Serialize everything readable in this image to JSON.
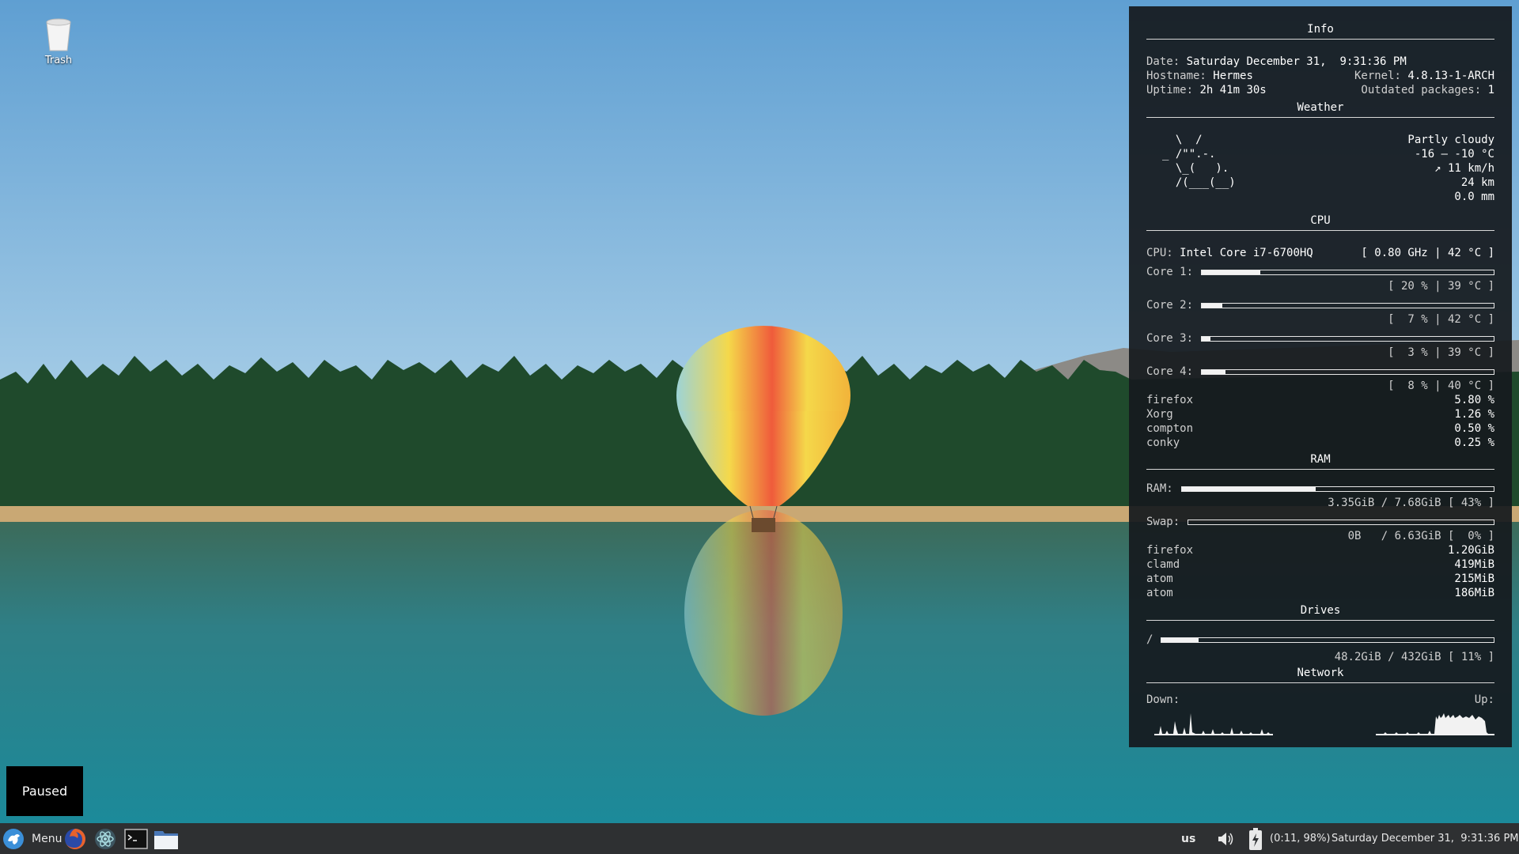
{
  "desktop": {
    "icons": [
      {
        "label": "Trash",
        "icon": "trash-icon"
      }
    ]
  },
  "conky": {
    "info": {
      "title": "Info",
      "date_label": "Date:",
      "date_value": "Saturday December 31,  9:31:36 PM",
      "hostname_label": "Hostname:",
      "hostname_value": "Hermes",
      "kernel_label": "Kernel:",
      "kernel_value": "4.8.13-1-ARCH",
      "uptime_label": "Uptime:",
      "uptime_value": "2h 41m 30s",
      "outdated_label": "Outdated packages:",
      "outdated_value": "1"
    },
    "weather": {
      "title": "Weather",
      "ascii_art": "  \\  /\n_ /\"\".-.\n  \\_(   ).\n  /(___(__)",
      "condition": "Partly cloudy",
      "temperature": "-16 – -10 °C",
      "wind": "↗ 11 km/h",
      "visibility": "24 km",
      "precipitation": "0.0 mm"
    },
    "cpu": {
      "title": "CPU",
      "label": "CPU:",
      "model": "Intel Core i7-6700HQ",
      "summary": "[ 0.80 GHz | 42 °C ]",
      "cores": [
        {
          "label": "Core 1:",
          "usage": 20,
          "stat": "[ 20 % | 39 °C ]"
        },
        {
          "label": "Core 2:",
          "usage": 7,
          "stat": "[  7 % | 42 °C ]"
        },
        {
          "label": "Core 3:",
          "usage": 3,
          "stat": "[  3 % | 39 °C ]"
        },
        {
          "label": "Core 4:",
          "usage": 8,
          "stat": "[  8 % | 40 °C ]"
        }
      ],
      "processes": [
        {
          "name": "firefox",
          "value": "5.80 %"
        },
        {
          "name": "Xorg",
          "value": "1.26 %"
        },
        {
          "name": "compton",
          "value": "0.50 %"
        },
        {
          "name": "conky",
          "value": "0.25 %"
        }
      ]
    },
    "ram": {
      "title": "RAM",
      "ram_label": "RAM:",
      "ram_usage": 43,
      "ram_stat": "3.35GiB / 7.68GiB [ 43% ]",
      "swap_label": "Swap:",
      "swap_usage": 0,
      "swap_stat": "0B   / 6.63GiB [  0% ]",
      "processes": [
        {
          "name": "firefox",
          "value": "1.20GiB"
        },
        {
          "name": "clamd",
          "value": "419MiB"
        },
        {
          "name": "atom",
          "value": "215MiB"
        },
        {
          "name": "atom",
          "value": "186MiB"
        }
      ]
    },
    "drives": {
      "title": "Drives",
      "root_label": "/",
      "root_usage": 11,
      "root_stat": "48.2GiB / 432GiB [ 11% ]"
    },
    "network": {
      "title": "Network",
      "down_label": "Down:",
      "up_label": "Up:"
    }
  },
  "notification": {
    "text": "Paused"
  },
  "taskbar": {
    "menu_label": "Menu",
    "launchers": [
      {
        "name": "firefox-launcher",
        "icon": "firefox-icon"
      },
      {
        "name": "atom-launcher",
        "icon": "atom-icon"
      },
      {
        "name": "terminal-launcher",
        "icon": "terminal-icon"
      },
      {
        "name": "files-launcher",
        "icon": "folder-icon"
      }
    ],
    "keyboard_layout": "us",
    "battery_text": "(0:11, 98%)",
    "clock": "Saturday December 31,  9:31:36 PM"
  }
}
